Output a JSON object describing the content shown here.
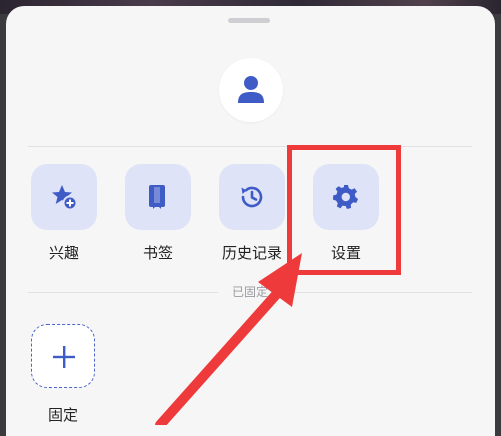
{
  "colors": {
    "accent": "#4a64c8",
    "tile_bg": "#dfe3f7",
    "annotation_red": "#ee3a3a"
  },
  "profile": {
    "icon": "user-icon"
  },
  "quick_actions": [
    {
      "label": "兴趣",
      "icon": "star-add-icon"
    },
    {
      "label": "书签",
      "icon": "bookmark-icon"
    },
    {
      "label": "历史记录",
      "icon": "history-icon"
    },
    {
      "label": "设置",
      "icon": "gear-icon"
    }
  ],
  "pinned_section": {
    "title": "已固定",
    "add_label": "固定",
    "add_icon": "plus-icon"
  }
}
